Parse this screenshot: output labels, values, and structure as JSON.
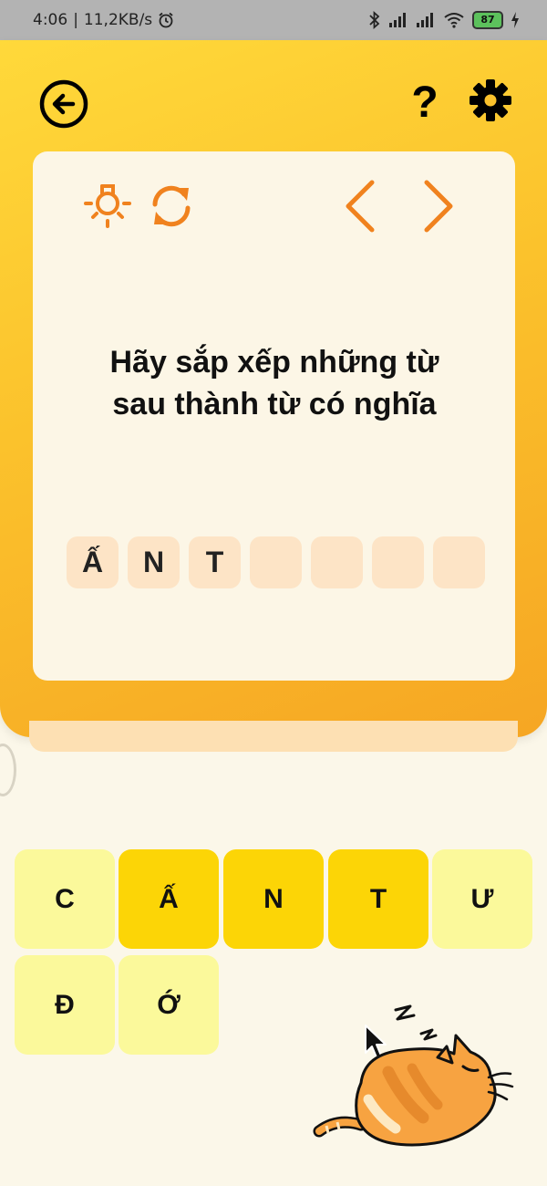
{
  "status_bar": {
    "time": "4:06",
    "speed": "11,2KB/s",
    "battery": "87"
  },
  "header": {
    "back_icon": "arrow-left-circle-icon",
    "help_label": "?",
    "settings_icon": "gear-icon"
  },
  "card": {
    "question": "Hãy sắp xếp những từ sau thành từ có nghĩa",
    "icons": [
      "lightbulb-icon",
      "refresh-icon",
      "chevron-left-icon",
      "chevron-right-icon"
    ],
    "answer_slots": [
      "Ấ",
      "N",
      "T",
      "",
      "",
      "",
      ""
    ]
  },
  "letter_tiles": [
    {
      "letter": "C",
      "used": false
    },
    {
      "letter": "Ấ",
      "used": true
    },
    {
      "letter": "N",
      "used": true
    },
    {
      "letter": "T",
      "used": true
    },
    {
      "letter": "Ư",
      "used": false
    },
    {
      "letter": "Đ",
      "used": false
    },
    {
      "letter": "Ớ",
      "used": false
    }
  ],
  "colors": {
    "accent_orange": "#f0821e",
    "header_yellow": "#fbc22c",
    "tile_used": "#fcd506",
    "tile_unused": "#fbf99b",
    "slot_bg": "#fde4c6"
  }
}
